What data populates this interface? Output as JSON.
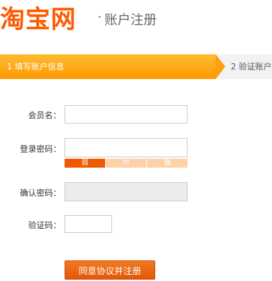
{
  "header": {
    "logo_text": "淘宝网",
    "separator": "•",
    "title": "账户注册"
  },
  "steps": [
    {
      "label": "1 填写账户信息",
      "active": true
    },
    {
      "label": "2 验证账户",
      "active": false
    }
  ],
  "form": {
    "username_label": "会员名：",
    "password_label": "登录密码：",
    "confirm_label": "确认密码：",
    "captcha_label": "验证码：",
    "username_value": "",
    "password_value": "",
    "confirm_value": "",
    "captcha_value": "",
    "strength": {
      "weak": "弱",
      "medium": "中",
      "strong": "强",
      "level": "weak"
    },
    "submit_label": "同意协议并注册"
  },
  "colors": {
    "brand": "#ff5a00",
    "step_active": "#ff9f0c",
    "button": "#e96a16"
  }
}
